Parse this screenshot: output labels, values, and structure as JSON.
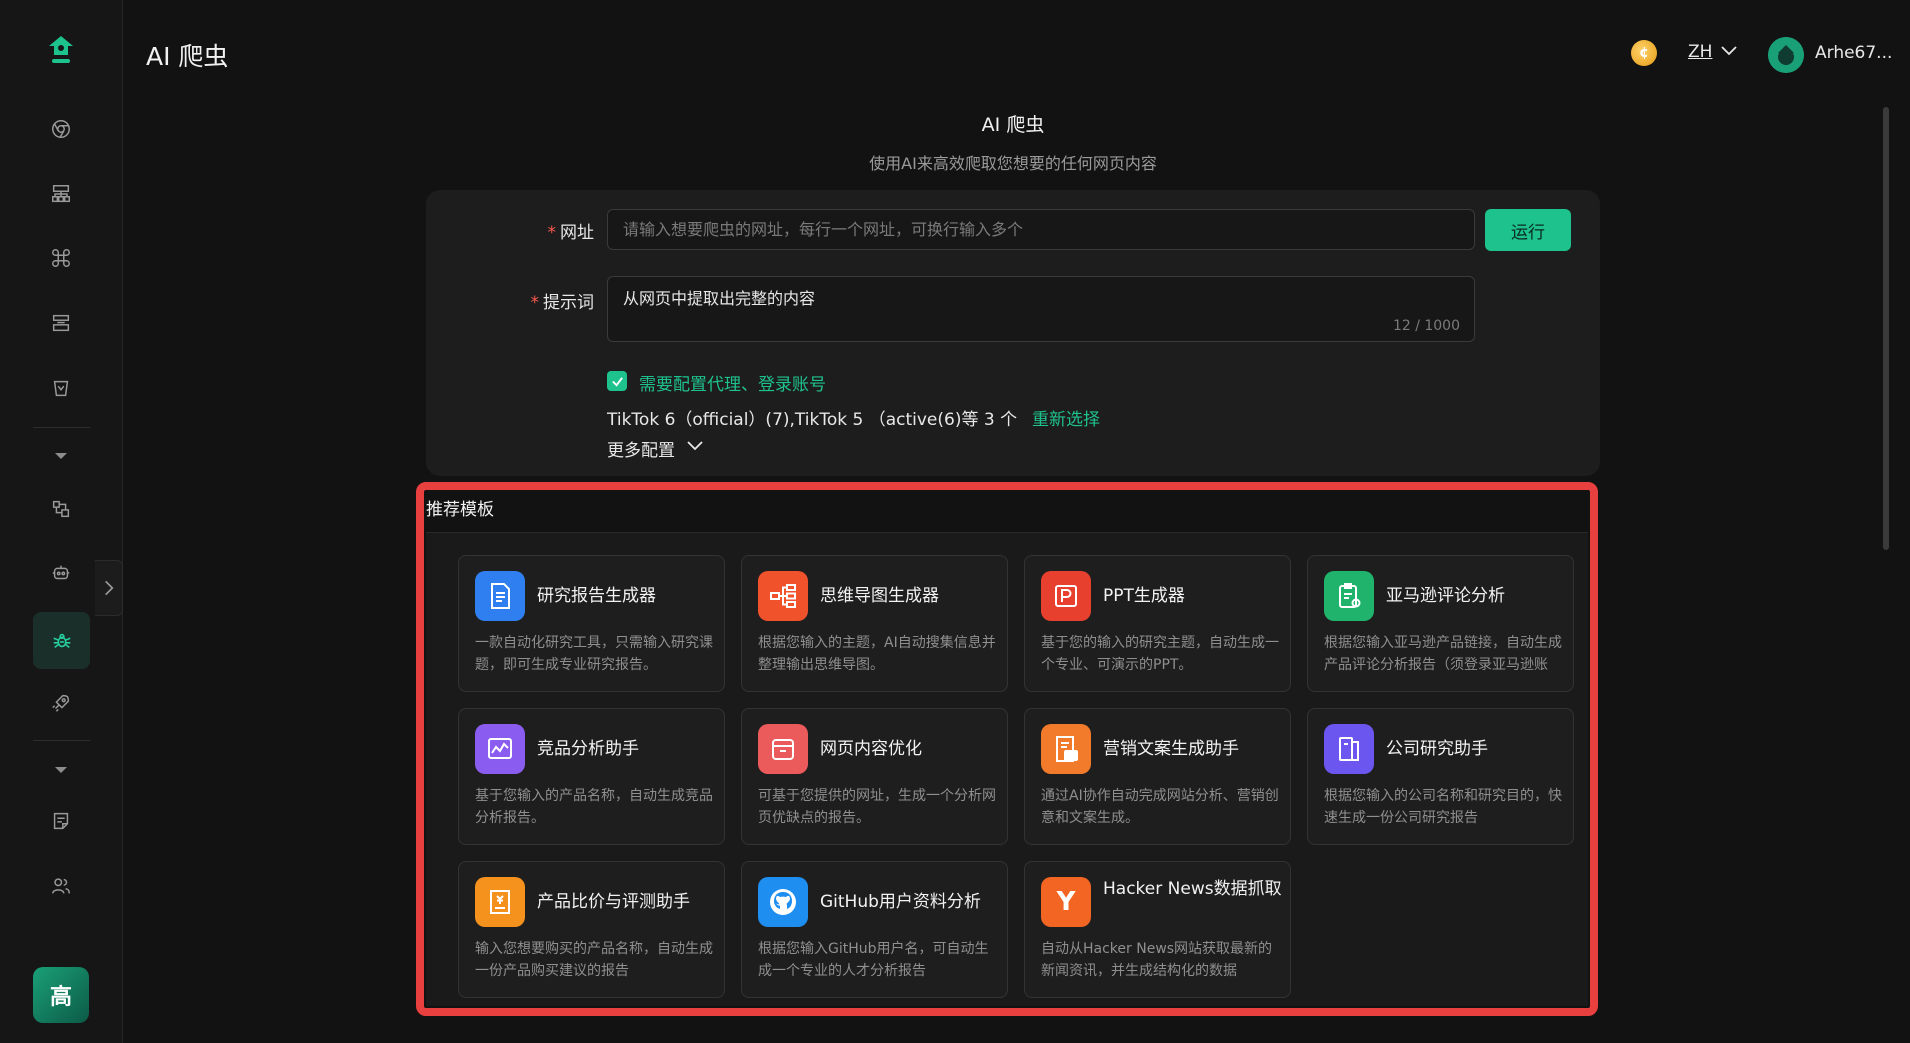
{
  "app": {
    "title": "AI 爬虫",
    "language": "ZH",
    "username": "Arhe67...",
    "sidebar_badge": "高"
  },
  "page": {
    "heading": "AI 爬虫",
    "subtitle": "使用AI来高效爬取您想要的任何网页内容"
  },
  "form": {
    "url_label": "网址",
    "url_placeholder": "请输入想要爬虫的网址，每行一个网址，可换行输入多个",
    "url_value": "",
    "run_label": "运行",
    "prompt_label": "提示词",
    "prompt_value": "从网页中提取出完整的内容",
    "prompt_count": "12 / 1000",
    "proxy_checkbox_label": "需要配置代理、登录账号",
    "proxy_checked": true,
    "accounts_text": "TikTok 6（official）(7),TikTok 5 （active(6)等 3 个",
    "reselect_label": "重新选择",
    "more_config_label": "更多配置"
  },
  "templates": {
    "section_title": "推荐模板",
    "items": [
      {
        "title": "研究报告生成器",
        "desc": "一款自动化研究工具，只需输入研究课题，即可生成专业研究报告。",
        "icon": "document-icon",
        "color": "#2f7ff0"
      },
      {
        "title": "思维导图生成器",
        "desc": "根据您输入的主题，AI自动搜集信息并整理输出思维导图。",
        "icon": "mindmap-icon",
        "color": "#f0522c"
      },
      {
        "title": "PPT生成器",
        "desc": "基于您的输入的研究主题，自动生成一个专业、可演示的PPT。",
        "icon": "ppt-icon",
        "color": "#e8402e"
      },
      {
        "title": "亚马逊评论分析",
        "desc": "根据您输入亚马逊产品链接，自动生成产品评论分析报告（须登录亚马逊账号）",
        "icon": "clipboard-icon",
        "color": "#1fb36b"
      },
      {
        "title": "竞品分析助手",
        "desc": "基于您输入的产品名称，自动生成竞品分析报告。",
        "icon": "chart-icon",
        "color": "#8a5cf0"
      },
      {
        "title": "网页内容优化",
        "desc": "可基于您提供的网址，生成一个分析网页优缺点的报告。",
        "icon": "archive-icon",
        "color": "#ec5b5b"
      },
      {
        "title": "营销文案生成助手",
        "desc": "通过AI协作自动完成网站分析、营销创意和文案生成。",
        "icon": "ai-doc-icon",
        "color": "#f27a2b"
      },
      {
        "title": "公司研究助手",
        "desc": "根据您输入的公司名称和研究目的，快速生成一份公司研究报告",
        "icon": "book-icon",
        "color": "#6b57f0"
      },
      {
        "title": "产品比价与评测助手",
        "desc": "输入您想要购买的产品名称，自动生成一份产品购买建议的报告",
        "icon": "price-doc-icon",
        "color": "#f5921e"
      },
      {
        "title": "GitHub用户资料分析",
        "desc": "根据您输入GitHub用户名，可自动生成一个专业的人才分析报告",
        "icon": "github-icon",
        "color": "#1e8ef0"
      },
      {
        "title": "Hacker News数据抓取",
        "desc": "自动从Hacker News网站获取最新的新闻资讯，并生成结构化的数据",
        "icon": "hacker-news-icon",
        "color": "#f26522",
        "glyph": "Y"
      }
    ]
  },
  "colors": {
    "accent": "#1ec28d",
    "highlight_frame": "#e8403f",
    "required": "#ff5a4f"
  }
}
